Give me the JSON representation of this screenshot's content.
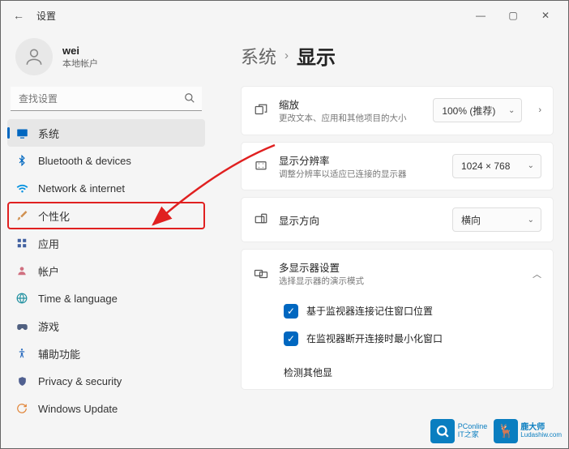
{
  "window": {
    "title": "设置"
  },
  "profile": {
    "name": "wei",
    "subtitle": "本地帐户"
  },
  "search": {
    "placeholder": "查找设置"
  },
  "nav": {
    "items": [
      {
        "label": "系统"
      },
      {
        "label": "Bluetooth & devices"
      },
      {
        "label": "Network & internet"
      },
      {
        "label": "个性化"
      },
      {
        "label": "应用"
      },
      {
        "label": "帐户"
      },
      {
        "label": "Time & language"
      },
      {
        "label": "游戏"
      },
      {
        "label": "辅助功能"
      },
      {
        "label": "Privacy & security"
      },
      {
        "label": "Windows Update"
      }
    ]
  },
  "breadcrumb": {
    "parent": "系统",
    "current": "显示"
  },
  "settings": {
    "scale": {
      "title": "缩放",
      "desc": "更改文本、应用和其他项目的大小",
      "value": "100% (推荐)"
    },
    "resolution": {
      "title": "显示分辨率",
      "desc": "调整分辨率以适应已连接的显示器",
      "value": "1024 × 768"
    },
    "orientation": {
      "title": "显示方向",
      "value": "横向"
    },
    "multidisplay": {
      "title": "多显示器设置",
      "desc": "选择显示器的演示模式",
      "check1": "基于监视器连接记住窗口位置",
      "check2": "在监视器断开连接时最小化窗口",
      "detect": "检测其他显"
    }
  },
  "watermarks": {
    "pconline": "PConline",
    "it_home": "IT之家",
    "ludashi_name": "鹿大师",
    "ludashi_url": "Ludashiw.com"
  }
}
